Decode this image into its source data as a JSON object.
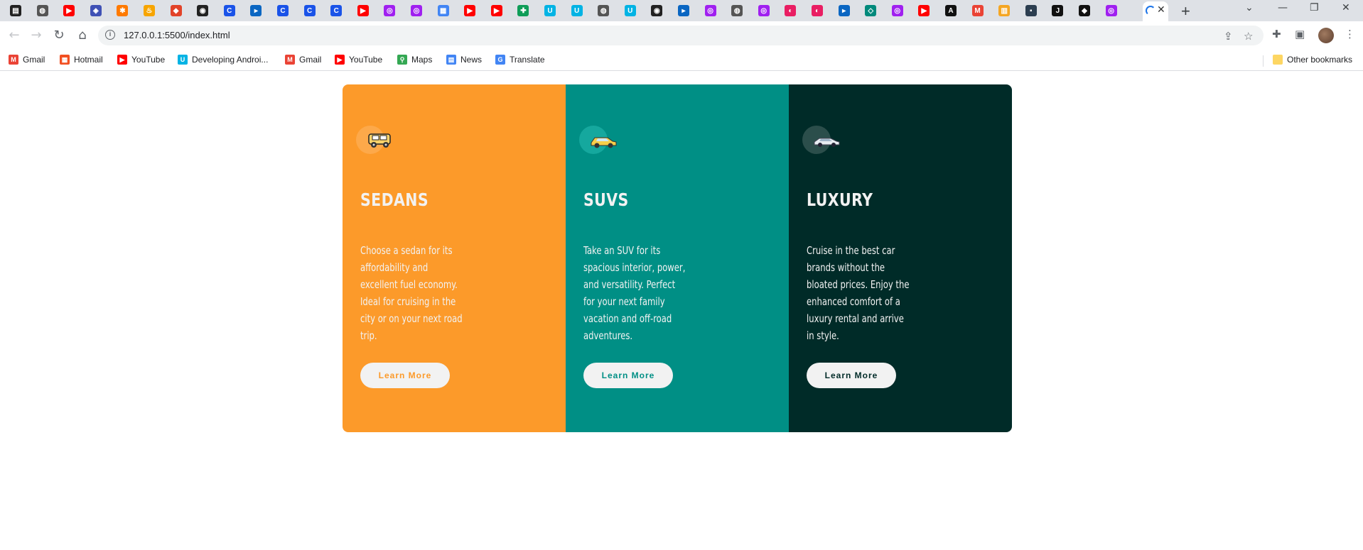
{
  "browser": {
    "url": "127.0.0.1:5500/index.html",
    "bookmarks": [
      {
        "label": "Gmail",
        "icon": "gmail-icon",
        "color": "#ea4335"
      },
      {
        "label": "Hotmail",
        "icon": "hotmail-icon",
        "color": "#f25022"
      },
      {
        "label": "YouTube",
        "icon": "youtube-icon",
        "color": "#ff0000"
      },
      {
        "label": "Developing Androi...",
        "icon": "udacity-icon",
        "color": "#02b3e4"
      },
      {
        "label": "Gmail",
        "icon": "gmail-icon",
        "color": "#ea4335"
      },
      {
        "label": "YouTube",
        "icon": "youtube-icon",
        "color": "#ff0000"
      },
      {
        "label": "Maps",
        "icon": "maps-icon",
        "color": "#34a853"
      },
      {
        "label": "News",
        "icon": "news-icon",
        "color": "#4285f4"
      },
      {
        "label": "Translate",
        "icon": "translate-icon",
        "color": "#4285f4"
      }
    ],
    "other_bookmarks": "Other bookmarks"
  },
  "cards": [
    {
      "title": "SEDANS",
      "text": "Choose a sedan for its affordability and excellent fuel economy. Ideal for cruising in the city or on your next road trip.",
      "button": "Learn More",
      "color": "#fc9a2a",
      "icon": "sedan-car-icon"
    },
    {
      "title": "SUVS",
      "text": "Take an SUV for its spacious interior, power, and versatility. Perfect for your next family vacation and off-road adventures.",
      "button": "Learn More",
      "color": "#008f85",
      "icon": "suv-car-icon"
    },
    {
      "title": "LUXURY",
      "text": "Cruise in the best car brands without the bloated prices. Enjoy the enhanced comfort of a luxury rental and arrive in style.",
      "button": "Learn More",
      "color": "#002b28",
      "icon": "luxury-car-icon"
    }
  ]
}
